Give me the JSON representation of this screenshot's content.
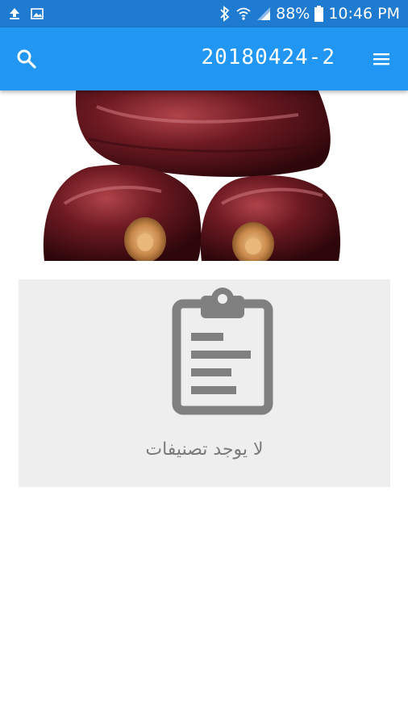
{
  "status_bar": {
    "battery": "88%",
    "time": "10:46 PM",
    "icons": [
      "upload-icon",
      "image-icon",
      "bluetooth-icon",
      "wifi-icon",
      "signal-icon",
      "battery-icon"
    ]
  },
  "app_bar": {
    "title": "20180424-2",
    "background": "#2196f3",
    "search_icon": "search-icon",
    "menu_icon": "menu-icon"
  },
  "empty_state": {
    "icon": "clipboard-icon",
    "message": "لا يوجد تصنيفات"
  }
}
